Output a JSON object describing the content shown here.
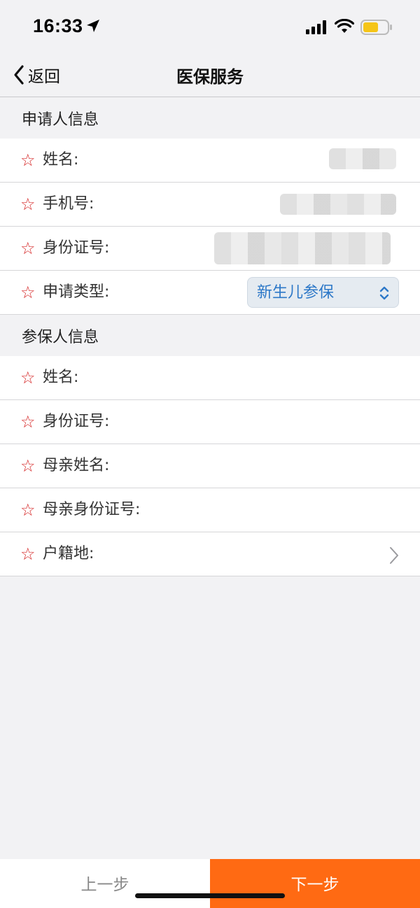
{
  "status_bar": {
    "time": "16:33",
    "icons": [
      "location-arrow-icon",
      "cellular-signal-icon",
      "wifi-icon",
      "battery-icon"
    ],
    "battery_color": "#f5c518"
  },
  "nav": {
    "back_label": "返回",
    "title": "医保服务"
  },
  "applicant_section": {
    "header": "申请人信息",
    "rows": [
      {
        "label": "姓名:"
      },
      {
        "label": "手机号:"
      },
      {
        "label": "身份证号:"
      },
      {
        "label": "申请类型:",
        "value": "新生儿参保"
      }
    ]
  },
  "insured_section": {
    "header": "参保人信息",
    "rows": [
      {
        "label": "姓名:"
      },
      {
        "label": "身份证号:"
      },
      {
        "label": "母亲姓名:"
      },
      {
        "label": "母亲身份证号:"
      },
      {
        "label": "户籍地:"
      }
    ]
  },
  "required_mark": "☆",
  "bottom_bar": {
    "prev_label": "上一步",
    "next_label": "下一步"
  },
  "colors": {
    "accent": "#ff6a13",
    "required_star": "#d62a2a",
    "select_text": "#2d78c8"
  }
}
